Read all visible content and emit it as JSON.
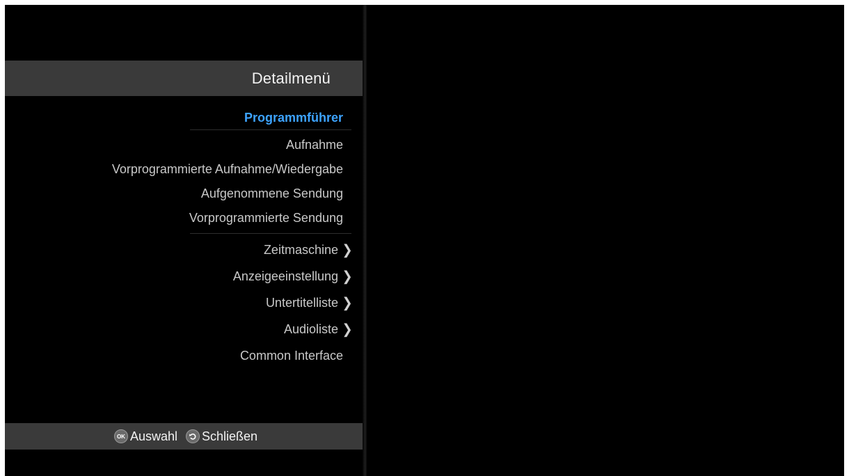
{
  "panel": {
    "title": "Detailmenü"
  },
  "menu": {
    "items": [
      {
        "label": "Programmführer",
        "active": true,
        "submenu": false
      },
      {
        "label": "Aufnahme",
        "active": false,
        "submenu": false
      },
      {
        "label": "Vorprogrammierte Aufnahme/Wiedergabe",
        "active": false,
        "submenu": false
      },
      {
        "label": "Aufgenommene Sendung",
        "active": false,
        "submenu": false
      },
      {
        "label": "Vorprogrammierte Sendung",
        "active": false,
        "submenu": false
      },
      {
        "label": "Zeitmaschine",
        "active": false,
        "submenu": true
      },
      {
        "label": "Anzeigeeinstellung",
        "active": false,
        "submenu": true
      },
      {
        "label": "Untertitelliste",
        "active": false,
        "submenu": true
      },
      {
        "label": "Audioliste",
        "active": false,
        "submenu": true
      },
      {
        "label": "Common Interface",
        "active": false,
        "submenu": false
      }
    ],
    "submenu_glyph": "❯"
  },
  "footer": {
    "ok_icon_text": "OK",
    "ok_label": "Auswahl",
    "back_label": "Schließen"
  },
  "colors": {
    "background": "#000000",
    "bar": "#3a3a3a",
    "active_text": "#3da3ff",
    "text": "#c8c8c8"
  }
}
